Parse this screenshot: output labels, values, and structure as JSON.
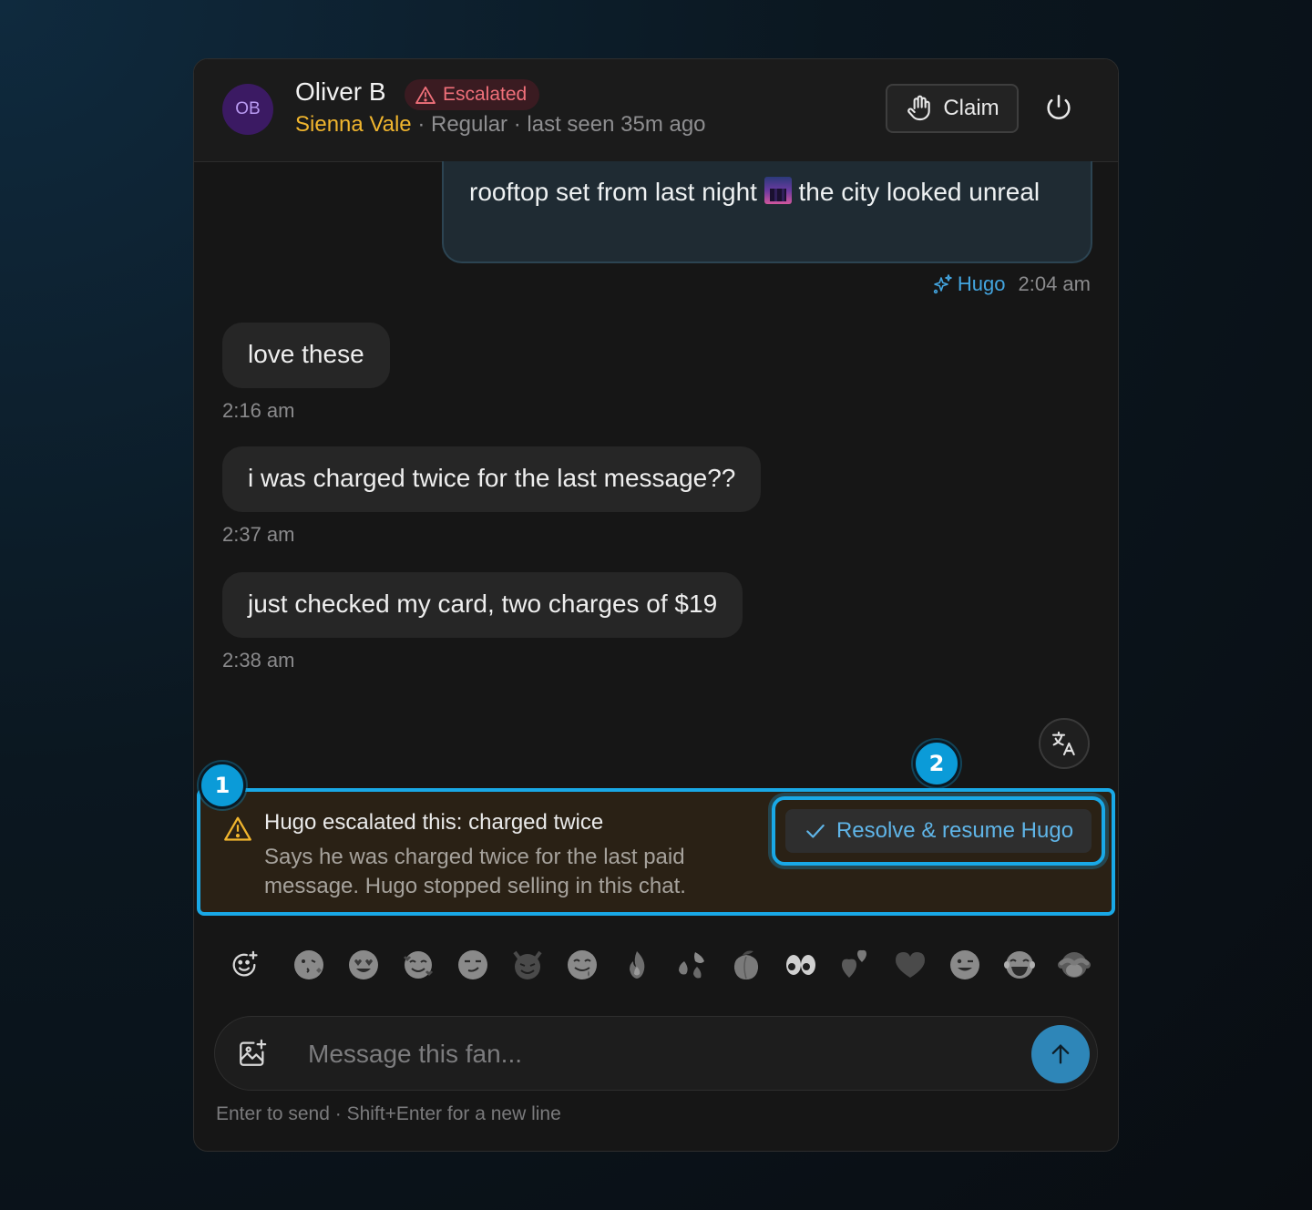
{
  "header": {
    "avatar_initials": "OB",
    "fan_name": "Oliver B",
    "status_badge": "Escalated",
    "creator_name": "Sienna Vale",
    "separator1": "·",
    "tier": "Regular",
    "separator2": "·",
    "last_seen": "last seen 35m ago",
    "claim_label": "Claim"
  },
  "messages": {
    "outgoing": {
      "text_before": "rooftop set from last night",
      "emoji_icon": "night-city-emoji",
      "text_after": "the city looked unreal",
      "sender": "Hugo",
      "time": "2:04 am"
    },
    "incoming": [
      {
        "text": "love these",
        "time": "2:16 am"
      },
      {
        "text": "i was charged twice for the last message??",
        "time": "2:37 am"
      },
      {
        "text": "just checked my card, two charges of $19",
        "time": "2:38 am"
      }
    ]
  },
  "escalation": {
    "title": "Hugo escalated this: charged twice",
    "description": "Says he was charged twice for the last paid message. Hugo stopped selling in this chat.",
    "resolve_label": "Resolve & resume Hugo"
  },
  "markers": {
    "one": "1",
    "two": "2"
  },
  "emoji_bar": [
    "emoji-picker-icon",
    "kissing-face",
    "heart-eyes",
    "smiling-hearts",
    "smirk",
    "smiling-devil",
    "drooling-face",
    "fire",
    "sweat-droplets",
    "peach",
    "eyes",
    "two-hearts",
    "black-heart",
    "winking-face",
    "tears-of-joy",
    "see-no-evil-monkey"
  ],
  "composer": {
    "placeholder": "Message this fan...",
    "hint": "Enter to send · Shift+Enter for a new line"
  },
  "colors": {
    "accent": "#19a8e6",
    "escalated": "#f0707a",
    "creator": "#f0b52e",
    "send": "#2e86b8"
  }
}
